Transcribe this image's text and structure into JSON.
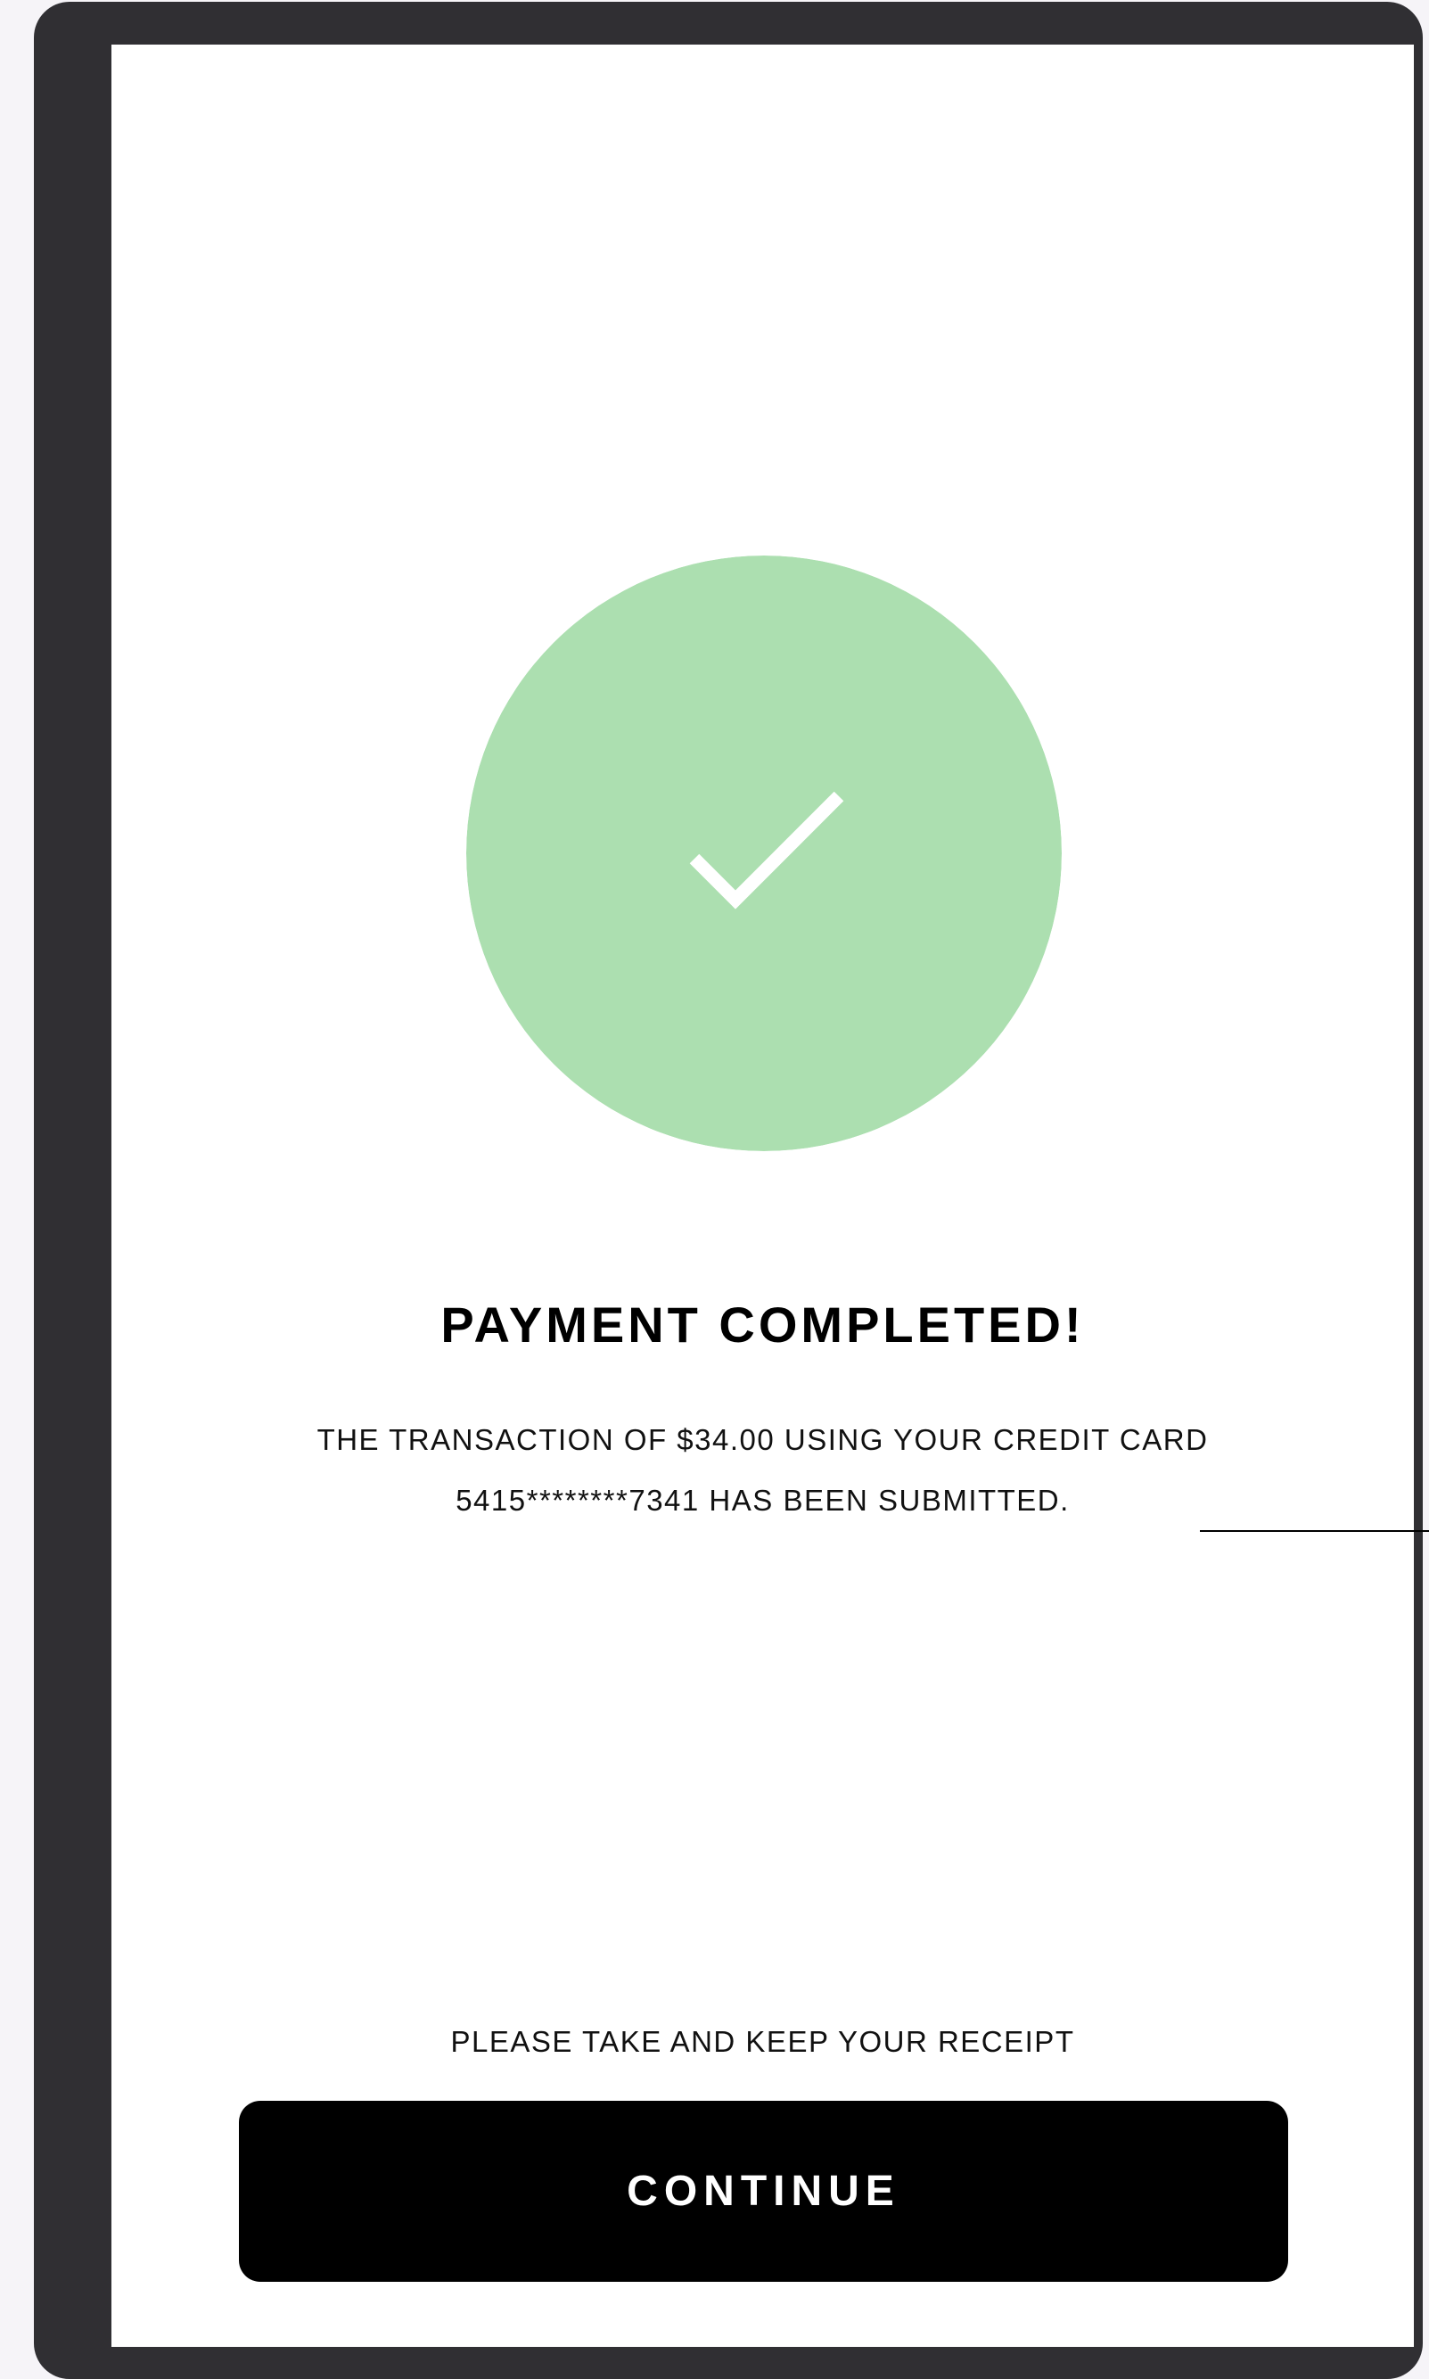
{
  "payment": {
    "title": "PAYMENT COMPLETED!",
    "message_line1": "THE TRANSACTION OF $34.00 USING YOUR CREDIT CARD",
    "message_line2": "5415********7341 HAS BEEN SUBMITTED.",
    "receipt_note": "PLEASE TAKE AND KEEP YOUR RECEIPT",
    "continue_label": "CONTINUE"
  },
  "icons": {
    "status": "check-icon"
  },
  "colors": {
    "success": "#acdfb0",
    "frame": "#302f33",
    "button": "#000000",
    "background": "#f6f4f8"
  }
}
